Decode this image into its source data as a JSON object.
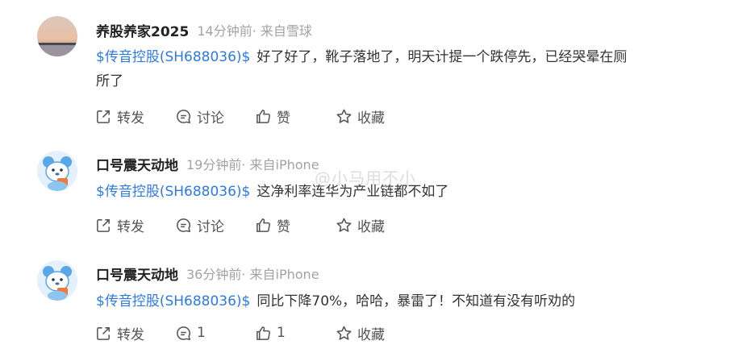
{
  "posts": [
    {
      "username": "养股养家2025",
      "meta": "14分钟前· 来自雪球",
      "stock_tag": "$传音控股(SH688036)$",
      "text_line1": "好了好了，靴子落地了，明天计提一个跌停先，已经哭晕在厕",
      "text_line2": "所了",
      "actions": {
        "repost": "转发",
        "comment": "讨论",
        "like": "赞",
        "favorite": "收藏"
      }
    },
    {
      "username": "口号震天动地",
      "meta": "19分钟前· 来自iPhone",
      "stock_tag": "$传音控股(SH688036)$",
      "text_line1": "这净利率连华为产业链都不如了",
      "actions": {
        "repost": "转发",
        "comment": "讨论",
        "like": "赞",
        "favorite": "收藏"
      }
    },
    {
      "username": "口号震天动地",
      "meta": "36分钟前· 来自iPhone",
      "stock_tag": "$传音控股(SH688036)$",
      "text_line1": "同比下降70%，哈哈，暴雷了！不知道有没有听劝的",
      "actions": {
        "repost": "转发",
        "comment": "1",
        "like": "1",
        "favorite": "收藏"
      }
    }
  ],
  "watermark": "@小马用不小",
  "colors": {
    "stock_link": "#2b7ae8",
    "meta_gray": "#a3a3a3",
    "text": "#333333"
  }
}
